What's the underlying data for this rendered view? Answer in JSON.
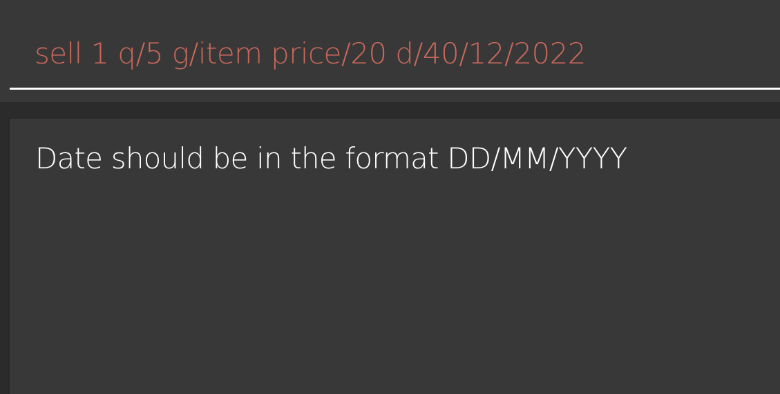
{
  "command_box": {
    "input_value": "sell 1 q/5 g/item price/20 d/40/12/2022",
    "text_color": "#c8685a",
    "underline_color": "#ffffff"
  },
  "result_display": {
    "message": "Date should be in the format DD/MM/YYYY",
    "text_color": "#ffffff"
  },
  "theme": {
    "background": "#2b2b2b",
    "panel": "#383838"
  }
}
